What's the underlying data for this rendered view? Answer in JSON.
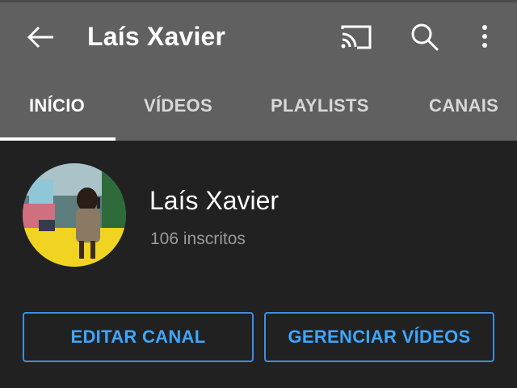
{
  "header": {
    "title": "Laís Xavier",
    "back_icon": "arrow-back-icon",
    "cast_icon": "cast-icon",
    "search_icon": "search-icon",
    "more_icon": "more-vertical-icon"
  },
  "tabs": [
    {
      "label": "INÍCIO",
      "active": true
    },
    {
      "label": "VÍDEOS",
      "active": false
    },
    {
      "label": "PLAYLISTS",
      "active": false
    },
    {
      "label": "CANAIS",
      "active": false
    }
  ],
  "channel": {
    "name": "Laís Xavier",
    "subscribers": "106 inscritos"
  },
  "actions": {
    "edit_label": "EDITAR CANAL",
    "manage_label": "GERENCIAR VÍDEOS"
  },
  "colors": {
    "appbar": "#606060",
    "background": "#212121",
    "accent": "#3ea6ff"
  }
}
